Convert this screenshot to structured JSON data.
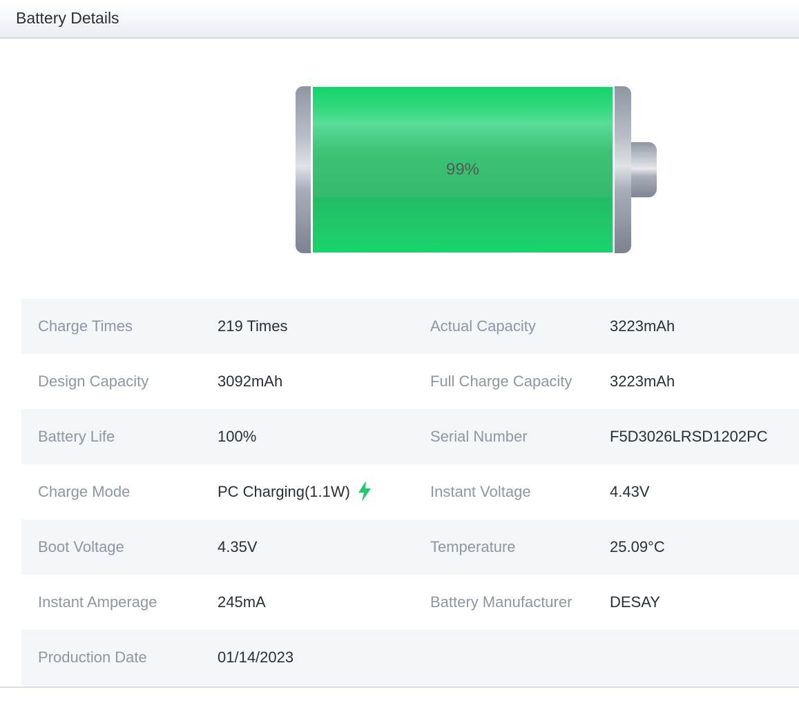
{
  "header": {
    "title": "Battery Details"
  },
  "battery": {
    "level_text": "99%",
    "level_fraction": 0.99,
    "fill_color": "#1fca69"
  },
  "details": {
    "rows": [
      {
        "l1": "Charge Times",
        "v1": "219 Times",
        "l2": "Actual Capacity",
        "v2": "3223mAh"
      },
      {
        "l1": "Design Capacity",
        "v1": "3092mAh",
        "l2": "Full Charge Capacity",
        "v2": "3223mAh"
      },
      {
        "l1": "Battery Life",
        "v1": "100%",
        "l2": "Serial Number",
        "v2": "F5D3026LRSD1202PC"
      },
      {
        "l1": "Charge Mode",
        "v1": "PC Charging(1.1W)",
        "v1_icon": "lightning-bolt-icon",
        "l2": "Instant Voltage",
        "v2": "4.43V"
      },
      {
        "l1": "Boot Voltage",
        "v1": "4.35V",
        "l2": "Temperature",
        "v2": "25.09°C"
      },
      {
        "l1": "Instant Amperage",
        "v1": "245mA",
        "l2": "Battery Manufacturer",
        "v2": "DESAY"
      },
      {
        "l1": "Production Date",
        "v1": "01/14/2023",
        "l2": "",
        "v2": ""
      }
    ]
  },
  "colors": {
    "accent_green": "#1fca69",
    "label_gray": "#8d96a3",
    "row_shade": "#f3f6f9"
  }
}
